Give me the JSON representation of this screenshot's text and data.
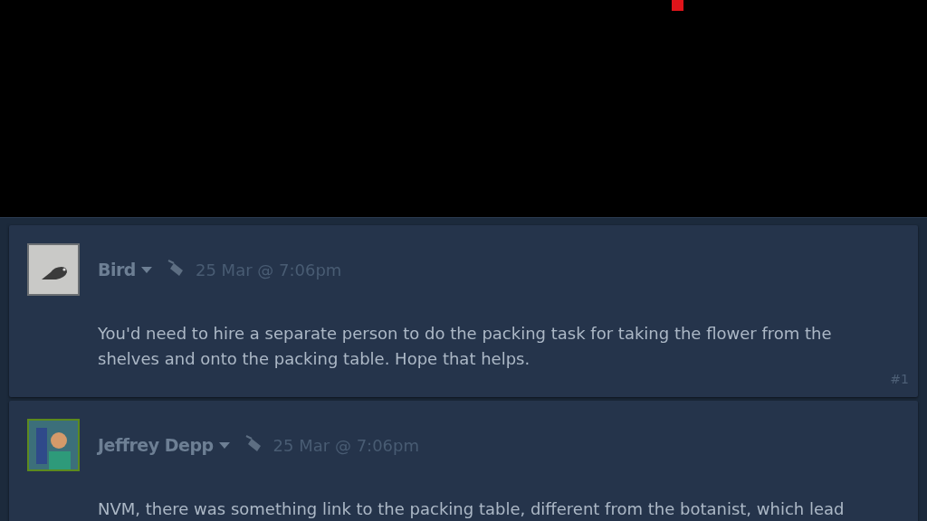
{
  "comments": [
    {
      "author": "Bird",
      "kind": "bird",
      "color": "#6b6f73",
      "timestamp": "25 Mar @ 7:06pm",
      "text": "You'd need to hire a separate person to do the packing task for taking the flower from the shelves and onto the packing table. Hope that helps.",
      "post_number": "#1"
    },
    {
      "author": "Jeffrey Depp",
      "kind": "picture",
      "color": "#5c8a1e",
      "timestamp": "25 Mar @ 7:06pm",
      "text": "NVM, there was something link to the packing table, different from the botanist, which lead"
    }
  ]
}
